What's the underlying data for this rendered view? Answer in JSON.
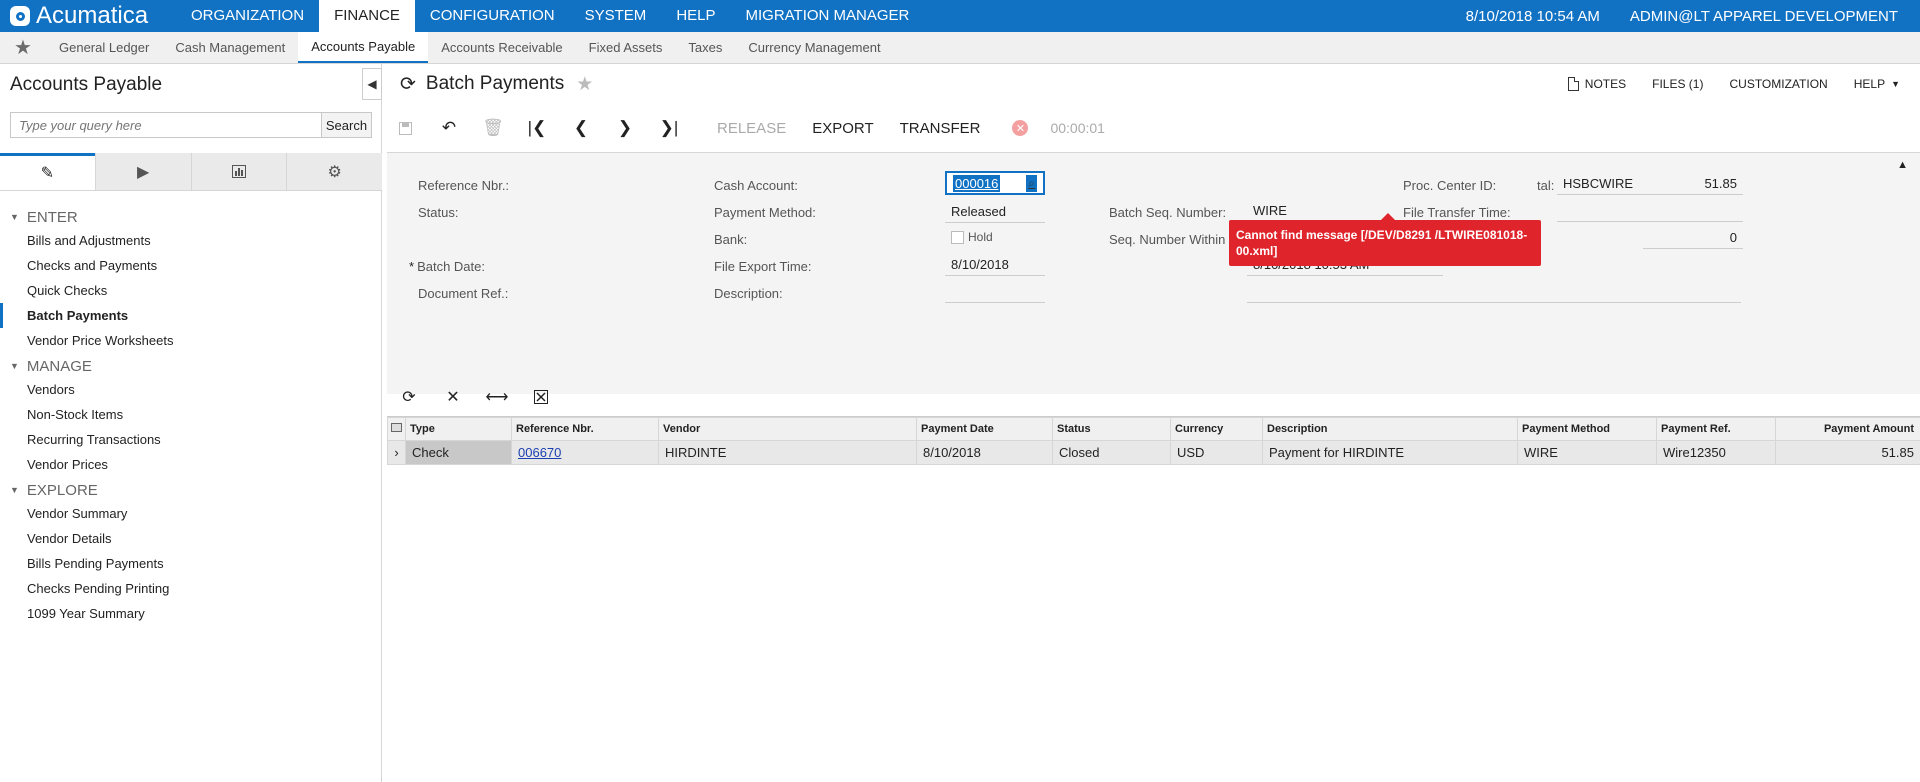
{
  "app": {
    "logo_text": "Acumatica",
    "accent_color": "#1172c4",
    "datetime": "8/10/2018  10:54 AM",
    "user": "ADMIN@LT APPAREL DEVELOPMENT"
  },
  "topnav": [
    "ORGANIZATION",
    "FINANCE",
    "CONFIGURATION",
    "SYSTEM",
    "HELP",
    "MIGRATION MANAGER"
  ],
  "subnav": [
    "General Ledger",
    "Cash Management",
    "Accounts Payable",
    "Accounts Receivable",
    "Fixed Assets",
    "Taxes",
    "Currency Management"
  ],
  "sidebar": {
    "title": "Accounts Payable",
    "search_placeholder": "Type your query here",
    "search_button": "Search",
    "sections": [
      {
        "label": "ENTER",
        "items": [
          "Bills and Adjustments",
          "Checks and Payments",
          "Quick Checks",
          "Batch Payments",
          "Vendor Price Worksheets"
        ]
      },
      {
        "label": "MANAGE",
        "items": [
          "Vendors",
          "Non-Stock Items",
          "Recurring Transactions",
          "Vendor Prices"
        ]
      },
      {
        "label": "EXPLORE",
        "items": [
          "Vendor Summary",
          "Vendor Details",
          "Bills Pending Payments",
          "Checks Pending Printing",
          "1099 Year Summary"
        ]
      }
    ]
  },
  "page": {
    "title": "Batch Payments",
    "notes": "NOTES",
    "files": "FILES (1)",
    "customization": "CUSTOMIZATION",
    "help": "HELP"
  },
  "toolbar": {
    "release": "RELEASE",
    "export": "EXPORT",
    "transfer": "TRANSFER",
    "timer": "00:00:01"
  },
  "error_message": "Cannot find message [/DEV/D8291 /LTWIRE081018-00.xml]",
  "form": {
    "ref_nbr_label": "Reference Nbr.:",
    "ref_nbr": "000016",
    "status_label": "Status:",
    "status": "Released",
    "hold_label": "Hold",
    "batch_date_label": "Batch Date:",
    "batch_date": "8/10/2018",
    "document_ref_label": "Document Ref.:",
    "cash_account_label": "Cash Account:",
    "payment_method_label": "Payment Method:",
    "payment_method": "WIRE",
    "bank_label": "Bank:",
    "file_export_time_label": "File Export Time:",
    "file_export_time": "8/10/2018 10:53 AM",
    "description_label": "Description:",
    "batch_total_label": "tal:",
    "batch_total": "51.85",
    "batch_seq_label": "Batch Seq. Number:",
    "seq_within_day_label": "Seq. Number Within Day:",
    "seq_within_day": "0",
    "proc_center_label": "Proc. Center ID:",
    "proc_center": "HSBCWIRE",
    "file_transfer_time_label": "File Transfer Time:"
  },
  "grid": {
    "columns": [
      "Type",
      "Reference Nbr.",
      "Vendor",
      "Payment Date",
      "Status",
      "Currency",
      "Description",
      "Payment Method",
      "Payment Ref.",
      "Payment Amount"
    ],
    "rows": [
      [
        "Check",
        "006670",
        "HIRDINTE",
        "8/10/2018",
        "Closed",
        "USD",
        "Payment for HIRDINTE",
        "WIRE",
        "Wire12350",
        "51.85"
      ]
    ]
  }
}
